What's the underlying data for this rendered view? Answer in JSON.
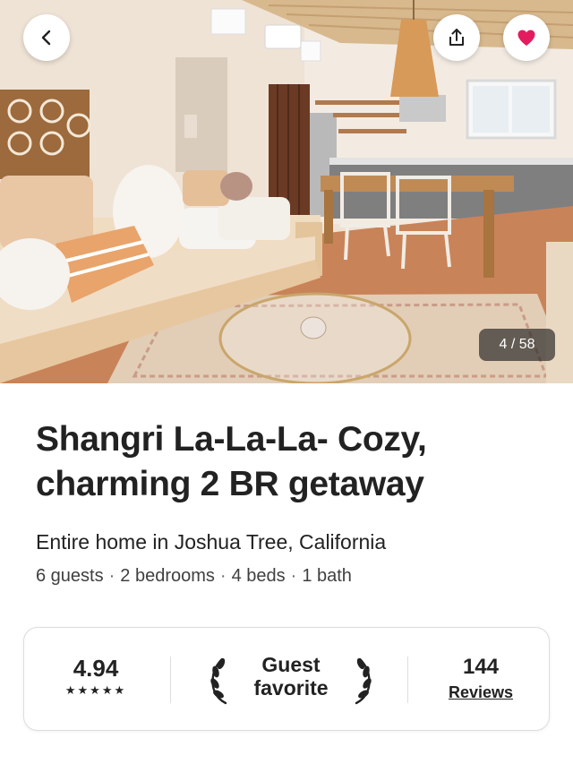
{
  "photo": {
    "counter": "4 / 58"
  },
  "actions": {
    "back_icon": "chevron-left-icon",
    "share_icon": "share-icon",
    "favorite_icon": "heart-icon",
    "favorite_color": "#E31C5F"
  },
  "listing": {
    "title": "Shangri La-La-La- Cozy, charming 2 BR getaway",
    "subtitle": "Entire home in Joshua Tree, California",
    "details": [
      "6 guests",
      "2 bedrooms",
      "4 beds",
      "1 bath"
    ],
    "separator": "·"
  },
  "rating_card": {
    "rating": "4.94",
    "stars": "★★★★★",
    "guest_favorite_line1": "Guest",
    "guest_favorite_line2": "favorite",
    "reviews_count": "144",
    "reviews_label": "Reviews"
  }
}
